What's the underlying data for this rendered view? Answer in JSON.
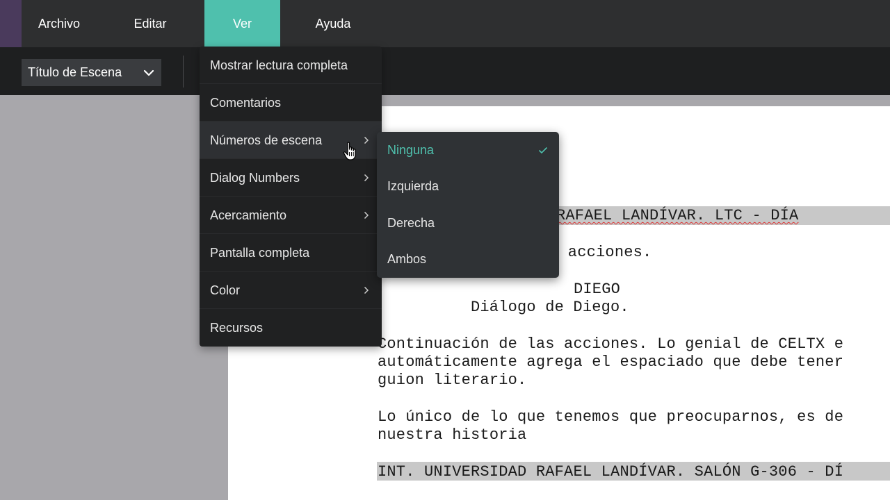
{
  "menubar": {
    "items": [
      "Archivo",
      "Editar",
      "Ver",
      "Ayuda"
    ],
    "active": "Ver",
    "accent_color": "#4fc0ad"
  },
  "toolbar": {
    "scene_select_value": "Título de Escena"
  },
  "view_menu": {
    "items": [
      "Mostrar lectura completa",
      "Comentarios",
      "Números de escena",
      "Dialog Numbers",
      "Acercamiento",
      "Pantalla completa",
      "Color",
      "Recursos"
    ],
    "hovered": "Números de escena"
  },
  "scene_numbers_submenu": {
    "items": [
      "Ninguna",
      "Izquierda",
      "Derecha",
      "Ambos"
    ],
    "selected": "Ninguna"
  },
  "script": {
    "heading1_visible": "RAFAEL LANDÍVAR. LTC - DÍA",
    "action1_visible": "s acciones.",
    "character": "DIEGO",
    "dialogue": "Diálogo de Diego.",
    "action2_line1": "Continuación de las acciones. Lo genial de CELTX e",
    "action2_line2": "automáticamente agrega el espaciado que debe tener",
    "action2_line3": "guion literario.",
    "action3_line1": "Lo único de lo que tenemos que preocuparnos, es de",
    "action3_line2": "nuestra historia",
    "heading2_visible": "INT. UNIVERSIDAD RAFAEL LANDÍVAR. SALÓN G-306 - DÍ"
  }
}
